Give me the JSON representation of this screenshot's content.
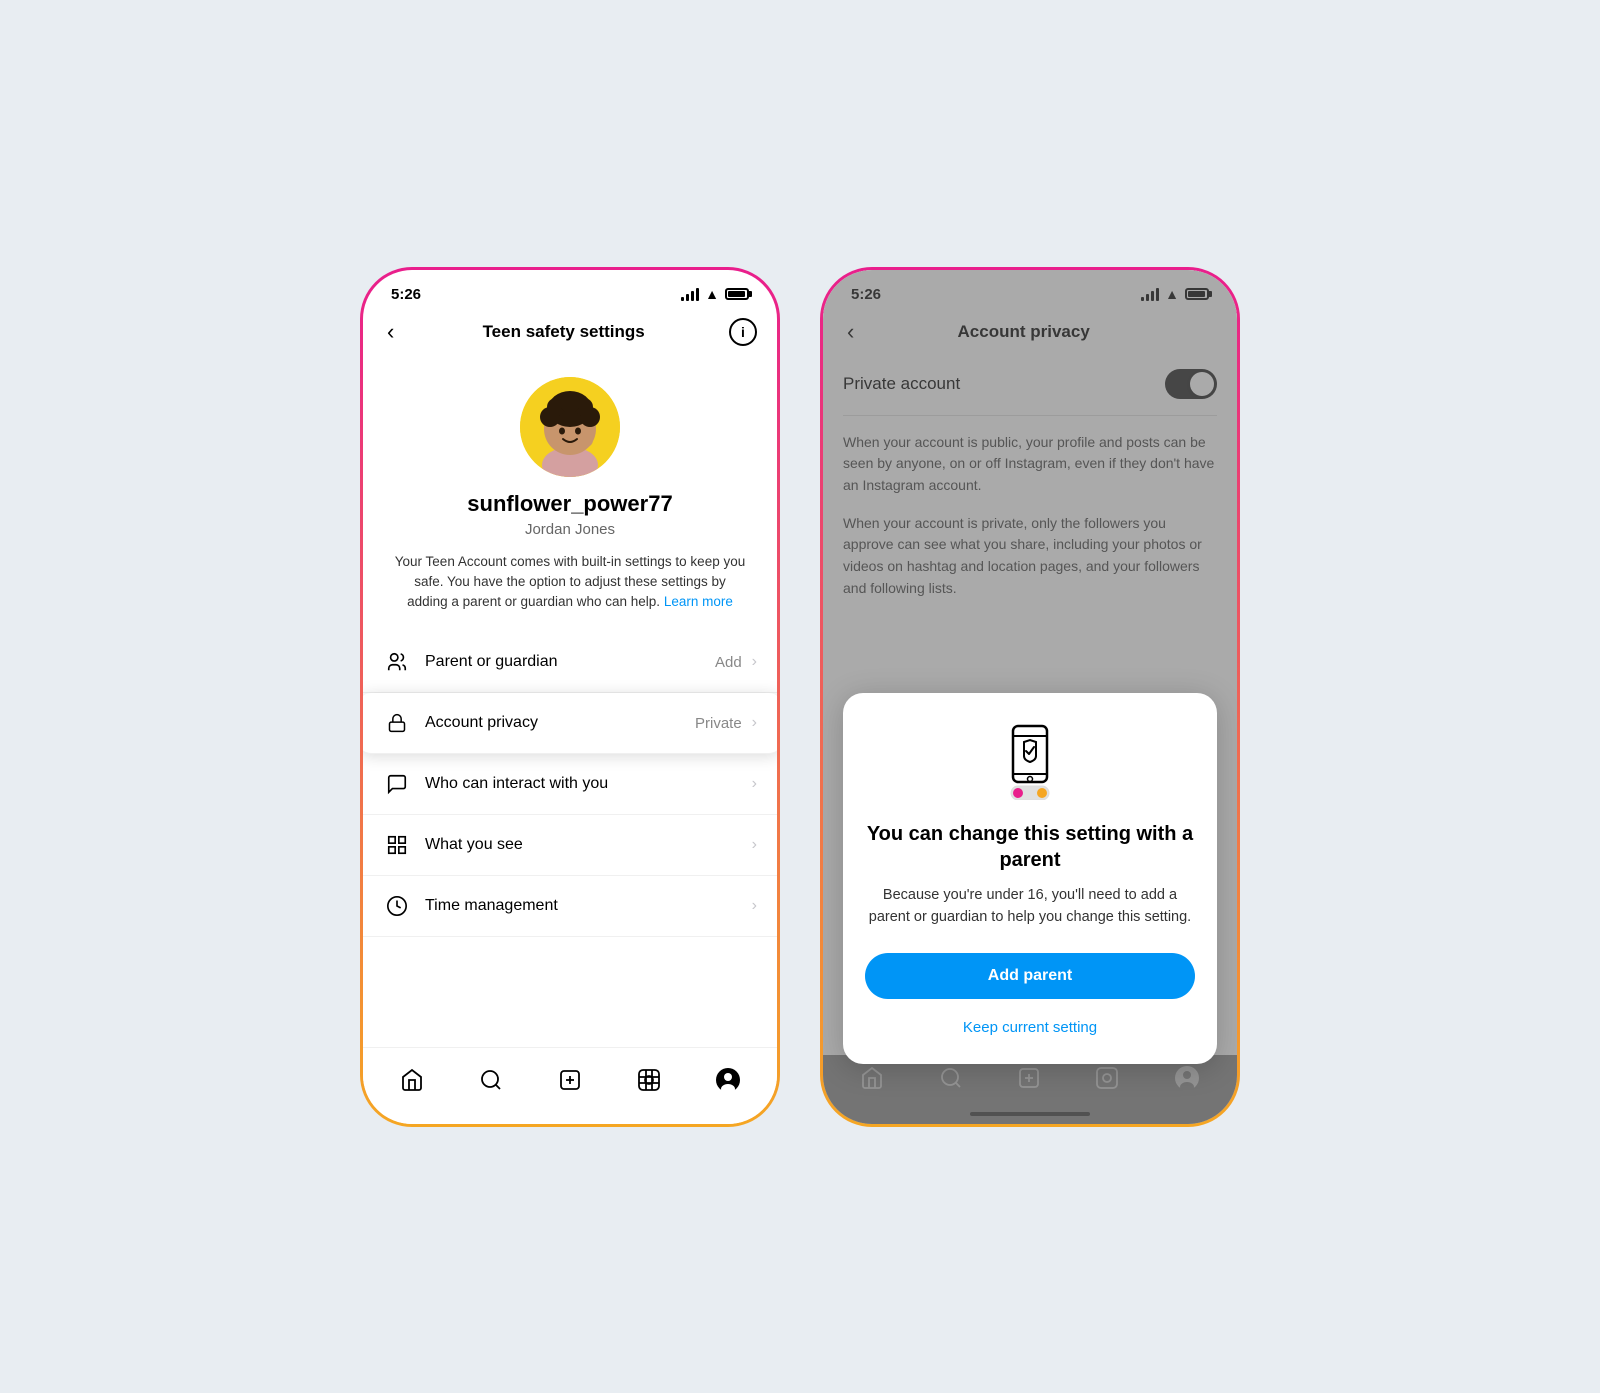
{
  "colors": {
    "accent_blue": "#0095f6",
    "gradient_start": "#e91e8c",
    "gradient_end": "#f5a623",
    "toggle_bg": "#222222",
    "text_dark": "#000000",
    "text_gray": "#888888",
    "text_medium": "#444444"
  },
  "left_phone": {
    "status_bar": {
      "time": "5:26"
    },
    "nav": {
      "title": "Teen safety settings",
      "back_label": "‹",
      "info_label": "i"
    },
    "profile": {
      "username": "sunflower_power77",
      "real_name": "Jordan Jones",
      "description": "Your Teen Account comes with built-in settings to keep you safe. You have the option to adjust these settings by adding a parent or guardian who can help.",
      "learn_more": "Learn more"
    },
    "settings_items": [
      {
        "id": "parent-guardian",
        "label": "Parent or guardian",
        "value": "Add",
        "icon": "people-icon"
      },
      {
        "id": "account-privacy",
        "label": "Account privacy",
        "value": "Private",
        "icon": "lock-icon",
        "highlighted": true
      },
      {
        "id": "who-can-interact",
        "label": "Who can interact with you",
        "value": "",
        "icon": "message-icon"
      },
      {
        "id": "what-you-see",
        "label": "What you see",
        "value": "",
        "icon": "grid-icon"
      },
      {
        "id": "time-management",
        "label": "Time management",
        "value": "",
        "icon": "clock-icon"
      }
    ],
    "bottom_nav": [
      "home-icon",
      "search-icon",
      "plus-icon",
      "reels-icon",
      "profile-icon"
    ]
  },
  "right_phone": {
    "status_bar": {
      "time": "5:26"
    },
    "nav": {
      "title": "Account privacy",
      "back_label": "‹"
    },
    "toggle_row": {
      "label": "Private account",
      "enabled": true
    },
    "description_1": "When your account is public, your profile and posts can be seen by anyone, on or off Instagram, even if they don't have an Instagram account.",
    "description_2": "When your account is private, only the followers you approve can see what you share, including your photos or videos on hashtag and location pages, and your followers and following lists.",
    "overlay_card": {
      "title": "You can change this setting with a parent",
      "description": "Because you're under 16, you'll need to add a parent or guardian to help you change this setting.",
      "add_parent_label": "Add parent",
      "keep_setting_label": "Keep current setting"
    }
  }
}
